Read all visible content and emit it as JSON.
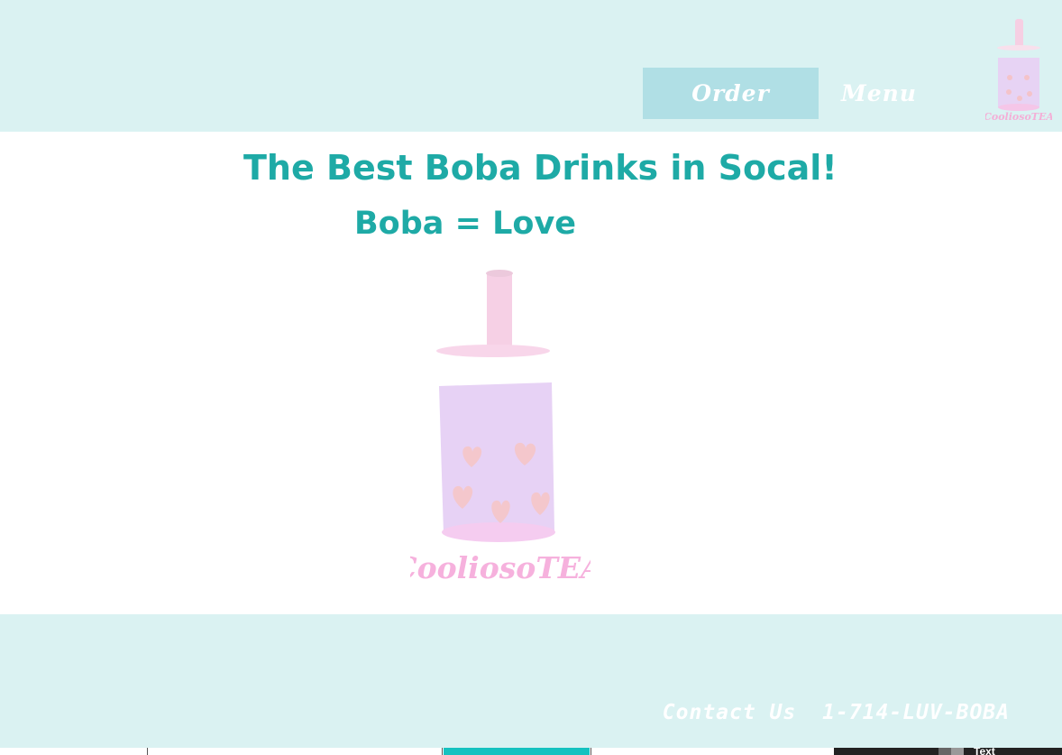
{
  "header": {
    "nav": {
      "order_label": "Order",
      "menu_label": "Menu"
    },
    "logo_text": "CooliosoTEA"
  },
  "hero": {
    "headline": "The Best Boba Drinks in Socal!",
    "subline": "Boba = Love",
    "logo_text": "CooliosoTEA"
  },
  "footer": {
    "contact_label": "Contact Us",
    "phone": "1-714-LUV-BOBA"
  },
  "taskbar": {
    "label": "Text"
  },
  "colors": {
    "header_bg": "#daf2f2",
    "accent_teal": "#1eaaa6",
    "order_button_bg": "#b0dfe5",
    "logo_pink": "#f7b8dc",
    "cup_lavender": "#e5d3f4"
  }
}
